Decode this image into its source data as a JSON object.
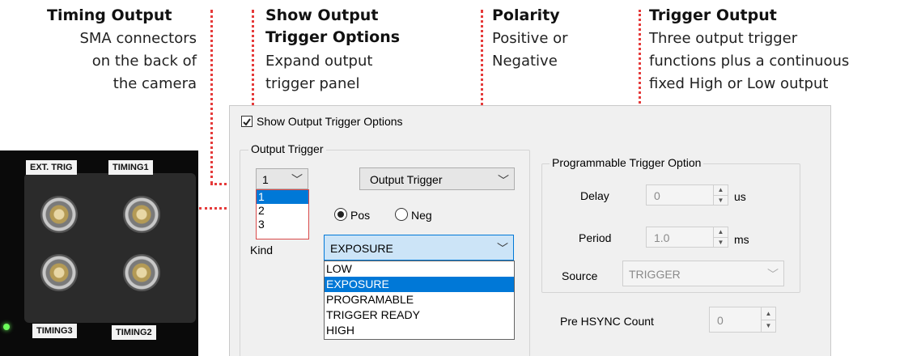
{
  "annotations": {
    "timing_output": {
      "title": "Timing Output",
      "lines": [
        "SMA connectors",
        "on the back of",
        "the camera"
      ]
    },
    "show_options": {
      "title_lines": [
        "Show Output",
        "Trigger Options"
      ],
      "lines": [
        "Expand output",
        "trigger panel"
      ]
    },
    "polarity": {
      "title": "Polarity",
      "lines": [
        "Positive or",
        "Negative"
      ]
    },
    "trigger_output": {
      "title": "Trigger Output",
      "lines": [
        "Three output trigger",
        "functions plus a continuous",
        "fixed High or Low output"
      ]
    }
  },
  "camera": {
    "labels": [
      "EXT. TRIG",
      "TIMING1",
      "TIMING3",
      "TIMING2"
    ]
  },
  "panel": {
    "show_options_checkbox": {
      "label": "Show Output Trigger Options",
      "checked": true
    },
    "output_trigger_group": {
      "title": "Output Trigger",
      "number_combo": {
        "value": "1",
        "options": [
          "1",
          "2",
          "3"
        ],
        "selected_index": 0
      },
      "mode_combo": {
        "value": "Output Trigger"
      },
      "polarity": {
        "options": [
          "Pos",
          "Neg"
        ],
        "selected": "Pos"
      },
      "kind_label": "Kind",
      "kind_combo": {
        "value": "EXPOSURE",
        "options": [
          "LOW",
          "EXPOSURE",
          "PROGRAMABLE",
          "TRIGGER READY",
          "HIGH"
        ],
        "selected_index": 1
      }
    },
    "programmable_group": {
      "title": "Programmable Trigger Option",
      "delay": {
        "label": "Delay",
        "value": "0",
        "unit": "us"
      },
      "period": {
        "label": "Period",
        "value": "1.0",
        "unit": "ms"
      },
      "source": {
        "label": "Source",
        "value": "TRIGGER"
      }
    },
    "pre_hsync": {
      "label": "Pre HSYNC Count",
      "value": "0"
    }
  },
  "colors": {
    "annotation_line": "#e53a3a",
    "selection": "#0078d7",
    "panel_bg": "#f0f0f0"
  }
}
